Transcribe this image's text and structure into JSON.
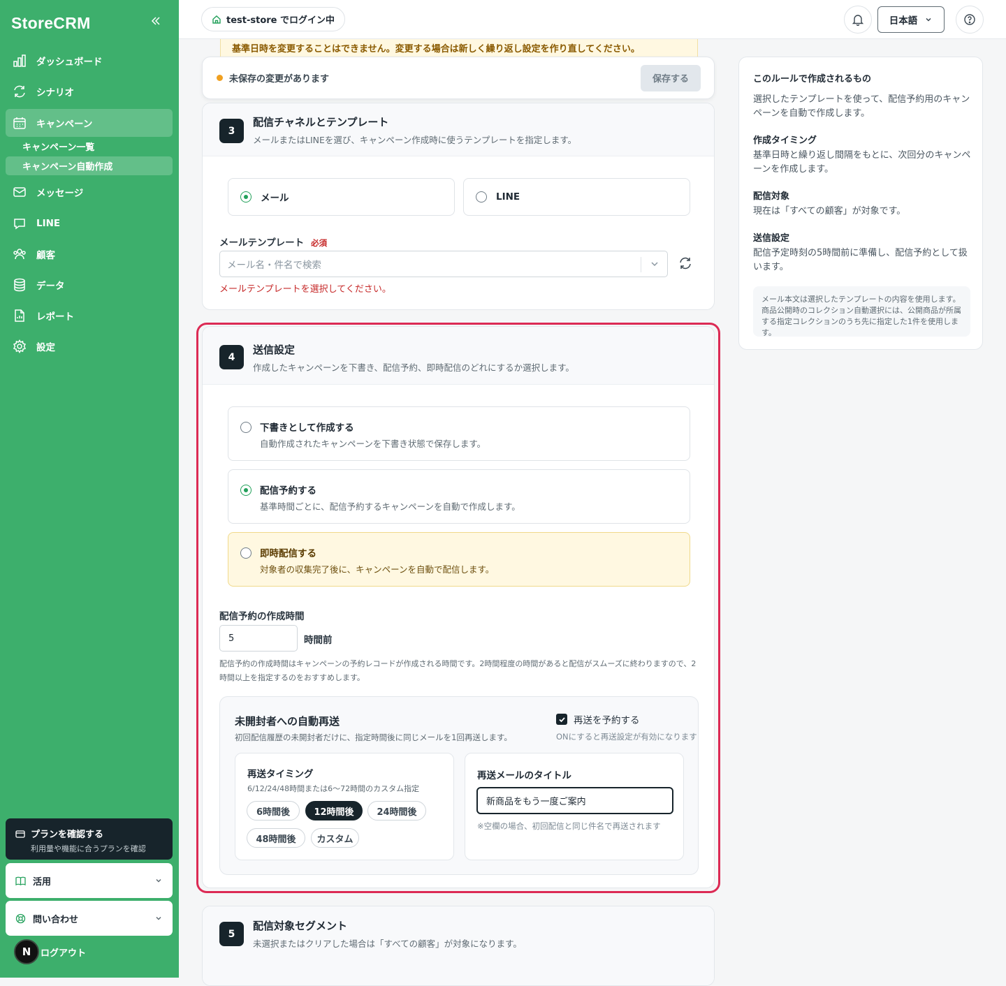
{
  "app": {
    "name": "StoreCRM"
  },
  "sidebar": {
    "items": [
      {
        "label": "ダッシュボード",
        "icon": "chart-bar-icon"
      },
      {
        "label": "シナリオ",
        "icon": "cycle-icon"
      },
      {
        "label": "キャンペーン",
        "icon": "calendar-icon"
      },
      {
        "label": "メッセージ",
        "icon": "mail-icon"
      },
      {
        "label": "LINE",
        "icon": "chat-icon"
      },
      {
        "label": "顧客",
        "icon": "users-icon"
      },
      {
        "label": "データ",
        "icon": "database-icon"
      },
      {
        "label": "レポート",
        "icon": "file-icon"
      },
      {
        "label": "設定",
        "icon": "gear-icon"
      }
    ],
    "subitems": [
      {
        "label": "キャンペーン一覧"
      },
      {
        "label": "キャンペーン自動作成"
      }
    ],
    "plan": {
      "title": "プランを確認する",
      "desc": "利用量や機能に合うプランを確認"
    },
    "accordions": [
      {
        "label": "活用"
      },
      {
        "label": "問い合わせ"
      }
    ],
    "logout": {
      "badge": "N",
      "label": "ログアウト"
    }
  },
  "topbar": {
    "login": "test-store でログイン中",
    "language": "日本語"
  },
  "banner": {
    "warning": "基準日時を変更することはできません。変更する場合は新しく繰り返し設定を作り直してください。"
  },
  "unsaved": {
    "text": "未保存の変更があります",
    "save": "保存する"
  },
  "section3": {
    "step": "3",
    "title": "配信チャネルとテンプレート",
    "desc": "メールまたはLINEを選び、キャンペーン作成時に使うテンプレートを指定します。",
    "channels": [
      {
        "label": "メール",
        "selected": true
      },
      {
        "label": "LINE",
        "selected": false
      }
    ],
    "template_label": "メールテンプレート",
    "required": "必須",
    "placeholder": "メール名・件名で検索",
    "error": "メールテンプレートを選択してください。"
  },
  "section4": {
    "step": "4",
    "title": "送信設定",
    "desc": "作成したキャンペーンを下書き、配信予約、即時配信のどれにするか選択します。",
    "options": [
      {
        "title": "下書きとして作成する",
        "desc": "自動作成されたキャンペーンを下書き状態で保存します。",
        "selected": false
      },
      {
        "title": "配信予約する",
        "desc": "基準時間ごとに、配信予約するキャンペーンを自動で作成します。",
        "selected": true
      },
      {
        "title": "即時配信する",
        "desc": "対象者の収集完了後に、キャンペーンを自動で配信します。",
        "selected": false
      }
    ],
    "hours_label": "配信予約の作成時間",
    "hours_value": "5",
    "hours_unit": "時間前",
    "hint": "配信予約の作成時間はキャンペーンの予約レコードが作成される時間です。2時間程度の時間があると配信がスムーズに終わりますので、2時間以上を指定するのをおすすめします。",
    "resend": {
      "title": "未開封者への自動再送",
      "desc": "初回配信履歴の未開封者だけに、指定時間後に同じメールを1回再送します。",
      "checkbox_label": "再送を予約する",
      "checked": true,
      "checkbox_note": "ONにすると再送設定が有効になります",
      "timing_title": "再送タイミング",
      "timing_desc": "6/12/24/48時間または6〜72時間のカスタム指定",
      "chips": [
        {
          "label": "6時間後",
          "selected": false
        },
        {
          "label": "12時間後",
          "selected": true
        },
        {
          "label": "24時間後",
          "selected": false
        },
        {
          "label": "48時間後",
          "selected": false
        },
        {
          "label": "カスタム",
          "selected": false
        }
      ],
      "mail_title_label": "再送メールのタイトル",
      "mail_title_value": "新商品をもう一度ご案内",
      "mail_title_note": "※空欄の場合、初回配信と同じ件名で再送されます"
    }
  },
  "section5": {
    "step": "5",
    "title": "配信対象セグメント",
    "desc": "未選択またはクリアした場合は「すべての顧客」が対象になります。"
  },
  "aside": {
    "heading": "このルールで作成されるもの",
    "intro": "選択したテンプレートを使って、配信予約用のキャンペーンを自動で作成します。",
    "items": [
      {
        "title": "作成タイミング",
        "text": "基準日時と繰り返し間隔をもとに、次回分のキャンペーンを作成します。"
      },
      {
        "title": "配信対象",
        "text": "現在は「すべての顧客」が対象です。"
      },
      {
        "title": "送信設定",
        "text": "配信予定時刻の5時間前に準備し、配信予約として扱います。"
      }
    ],
    "note": "メール本文は選択したテンプレートの内容を使用します。商品公開時のコレクション自動選択には、公開商品が所属する指定コレクションのうち先に指定した1件を使用します。"
  },
  "colors": {
    "brand": "#3daf6c",
    "dark": "#17242b",
    "highlight": "#dc2a54",
    "error": "#c62828",
    "accent": "#22a05a"
  }
}
